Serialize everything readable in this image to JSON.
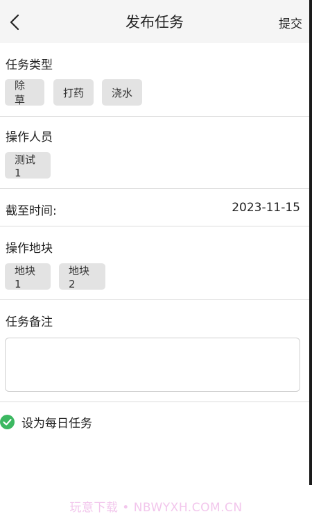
{
  "header": {
    "title": "发布任务",
    "submit_label": "提交"
  },
  "task_type": {
    "label": "任务类型",
    "options": [
      "除草",
      "打药",
      "浇水"
    ]
  },
  "operators": {
    "label": "操作人员",
    "items": [
      "测试1"
    ]
  },
  "deadline": {
    "label": "截至时间:",
    "value": "2023-11-15"
  },
  "plots": {
    "label": "操作地块",
    "items": [
      "地块1",
      "地块2"
    ]
  },
  "remark": {
    "label": "任务备注",
    "value": ""
  },
  "daily_task": {
    "label": "设为每日任务",
    "checked": true,
    "color": "#3cb861"
  },
  "watermark": "玩意下载 • NBWYXH.COM.CN"
}
